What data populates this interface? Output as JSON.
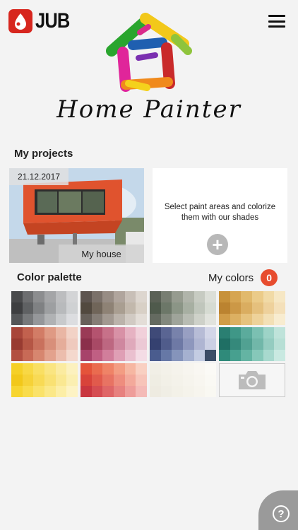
{
  "header": {
    "brand": "JUB",
    "app_title": "Home Painter"
  },
  "projects": {
    "title": "My projects",
    "items": [
      {
        "date": "21.12.2017",
        "name": "My house"
      }
    ],
    "new_card": {
      "text": "Select paint areas and colorize them with our shades",
      "plus": "+"
    }
  },
  "palette": {
    "title": "Color palette",
    "my_colors_label": "My colors",
    "my_colors_count": "0",
    "tiles": [
      {
        "name": "grays",
        "colors": [
          "#4a4b4d",
          "#6d6e70",
          "#8c8d8f",
          "#a4a5a7",
          "#bcbdbf",
          "#d3d4d6",
          "#3e3f41",
          "#5f6163",
          "#7f8183",
          "#9d9fa1",
          "#b8babc",
          "#cfd1d3",
          "#555759",
          "#77797b",
          "#95979a",
          "#b0b2b4",
          "#c8cacc",
          "#dcdde0"
        ]
      },
      {
        "name": "warm-grays",
        "colors": [
          "#5e5550",
          "#7b716a",
          "#978c84",
          "#b0a59d",
          "#c8bfb7",
          "#ddd6cf",
          "#52493f",
          "#706559",
          "#8e8275",
          "#a99e91",
          "#c2b8ac",
          "#d8d0c6",
          "#67605a",
          "#857d76",
          "#a29991",
          "#bbb3ab",
          "#d1cac3",
          "#e3ddd7"
        ]
      },
      {
        "name": "green-grays",
        "colors": [
          "#5b6156",
          "#787e72",
          "#969b8f",
          "#b0b4aa",
          "#c7cbc2",
          "#dcdfd8",
          "#4f5a4c",
          "#6c7768",
          "#8b9586",
          "#a7afa2",
          "#c0c6bc",
          "#d6dbd2",
          "#646a60",
          "#82887d",
          "#9fa49a",
          "#b8bcb3",
          "#ced1c9",
          "#e1e3dd"
        ]
      },
      {
        "name": "ochres",
        "colors": [
          "#c7913a",
          "#d6a552",
          "#e1b96c",
          "#ebcb89",
          "#f1daa6",
          "#f6e7c4",
          "#bb8330",
          "#cc9846",
          "#daad60",
          "#e5c07d",
          "#eed19c",
          "#f4e0ba",
          "#d09c48",
          "#dcb062",
          "#e6c27d",
          "#eed29a",
          "#f3e0b6",
          "#f8ecd0"
        ]
      },
      {
        "name": "terracotta",
        "colors": [
          "#a8463a",
          "#c2614e",
          "#d27c66",
          "#df9a84",
          "#e9b6a4",
          "#f2d2c6",
          "#983b31",
          "#b55645",
          "#c9715d",
          "#d88f7a",
          "#e5ad9a",
          "#efcabe",
          "#b24f41",
          "#c86a56",
          "#d7866f",
          "#e3a28d",
          "#ecbdad",
          "#f4d8cd"
        ]
      },
      {
        "name": "berries",
        "colors": [
          "#9a3a56",
          "#b4536f",
          "#c77189",
          "#d891a6",
          "#e6b2c2",
          "#f1d0da",
          "#8b2f4b",
          "#a84965",
          "#bd6781",
          "#cf879f",
          "#dfa9bb",
          "#ecc9d5",
          "#a7436a",
          "#c05f83",
          "#d17e9b",
          "#df9fb5",
          "#eac0cf",
          "#f4dce5"
        ]
      },
      {
        "name": "blues",
        "colors": [
          "#3f4a78",
          "#5a6593",
          "#7882ab",
          "#989fc2",
          "#b7bcd6",
          "#d3d6e8",
          "#354170",
          "#505c8b",
          "#6e79a5",
          "#8e97bd",
          "#afb5d2",
          "#ccd0e4",
          "#4a5c8e",
          "#6678a6",
          "#8594bb",
          "#a5b1d0",
          "#c3cce2",
          "#3c4d66"
        ]
      },
      {
        "name": "teals",
        "colors": [
          "#2a7f72",
          "#3f9787",
          "#5bab9c",
          "#7bc0b2",
          "#9dd3c7",
          "#bfe3da",
          "#1f6f64",
          "#35897b",
          "#51a192",
          "#71b7a9",
          "#94ccc0",
          "#b7dfd5",
          "#2f8a7a",
          "#47a08f",
          "#64b4a3",
          "#86c8b9",
          "#a8d9ce",
          "#c9e9e1"
        ]
      },
      {
        "name": "yellows",
        "colors": [
          "#f5d027",
          "#f8d845",
          "#f9df63",
          "#fae581",
          "#fbeba0",
          "#fcf1be",
          "#f2c81a",
          "#f6d238",
          "#f8da55",
          "#f9e173",
          "#fae892",
          "#fbefb1",
          "#f7d530",
          "#f9dc4c",
          "#fae26a",
          "#fbe888",
          "#fcee a6",
          "#fdf3c4"
        ]
      },
      {
        "name": "reds",
        "colors": [
          "#e4533a",
          "#ea6b4f",
          "#ef8367",
          "#f39d83",
          "#f6b7a2",
          "#f9d0c2",
          "#d8433a",
          "#e15a4c",
          "#e87363",
          "#ee8d7e",
          "#f3a99b",
          "#f7c4b9",
          "#c9363f",
          "#d54d52",
          "#df6667",
          "#e7817f",
          "#ee9d9a",
          "#f4bab7"
        ]
      },
      {
        "name": "whites",
        "colors": [
          "#f1efe6",
          "#f3f1e9",
          "#f5f3ec",
          "#f7f5ef",
          "#f9f7f2",
          "#fbfaf6",
          "#efede3",
          "#f2f0e7",
          "#f4f2ea",
          "#f6f4ed",
          "#f8f6f0",
          "#faf9f4",
          "#eeebe1",
          "#f0eee5",
          "#f3f1e8",
          "#f5f3eb",
          "#f7f5ee",
          "#f9f8f2"
        ]
      }
    ]
  },
  "colors": {
    "brand_red": "#d7261e",
    "badge_red": "#e74c2e",
    "background": "#f3f3f3"
  }
}
